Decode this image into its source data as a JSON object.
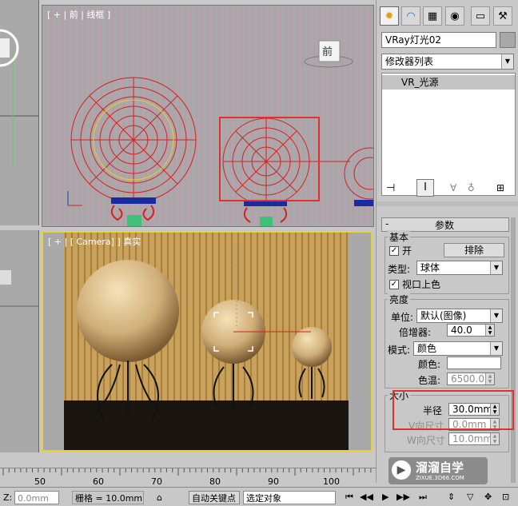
{
  "viewports": {
    "front_label": "[ + | 前 | 线框 ]",
    "camera_label": "[ + | [ Camera] ] 真实",
    "view_cube": "前"
  },
  "panel": {
    "tabs": [
      "create-icon",
      "modify-icon",
      "hierarchy-icon",
      "motion-icon",
      "display-icon",
      "utilities-icon"
    ],
    "object_name": "VRay灯光02",
    "modifier_list": "修改器列表",
    "stack_item": "VR_光源",
    "rollout_title": "参数",
    "general": {
      "title": "基本",
      "on_label": "开",
      "exclude": "排除",
      "type_label": "类型:",
      "type_value": "球体",
      "viewport_color": "视口上色"
    },
    "intensity": {
      "title": "亮度",
      "unit_label": "单位:",
      "unit_value": "默认(图像)",
      "multiplier_label": "倍增器:",
      "multiplier_value": "40.0",
      "mode_label": "模式:",
      "mode_value": "颜色",
      "color_label": "颜色:",
      "temp_label": "色温:",
      "temp_value": "6500.0"
    },
    "size": {
      "title": "大小",
      "radius_label": "半径",
      "radius_value": "30.0mm",
      "v_label": "V向尺寸",
      "v_value": "0.0mm",
      "w_label": "W向尺寸",
      "w_value": "10.0mm"
    }
  },
  "ruler": {
    "ticks": [
      "50",
      "60",
      "70",
      "80",
      "90",
      "100"
    ]
  },
  "status": {
    "z_label": "Z:",
    "z_value": "0.0mm",
    "grid": "栅格 = 10.0mm",
    "auto_key": "自动关键点",
    "selection": "选定对象"
  },
  "watermark": {
    "brand": "溜溜自学",
    "url": "ZIXUE.3D66.COM"
  },
  "colors": {
    "wire_red": "#d42020",
    "highlight": "#e03030",
    "camera_border": "#e6d23a"
  }
}
